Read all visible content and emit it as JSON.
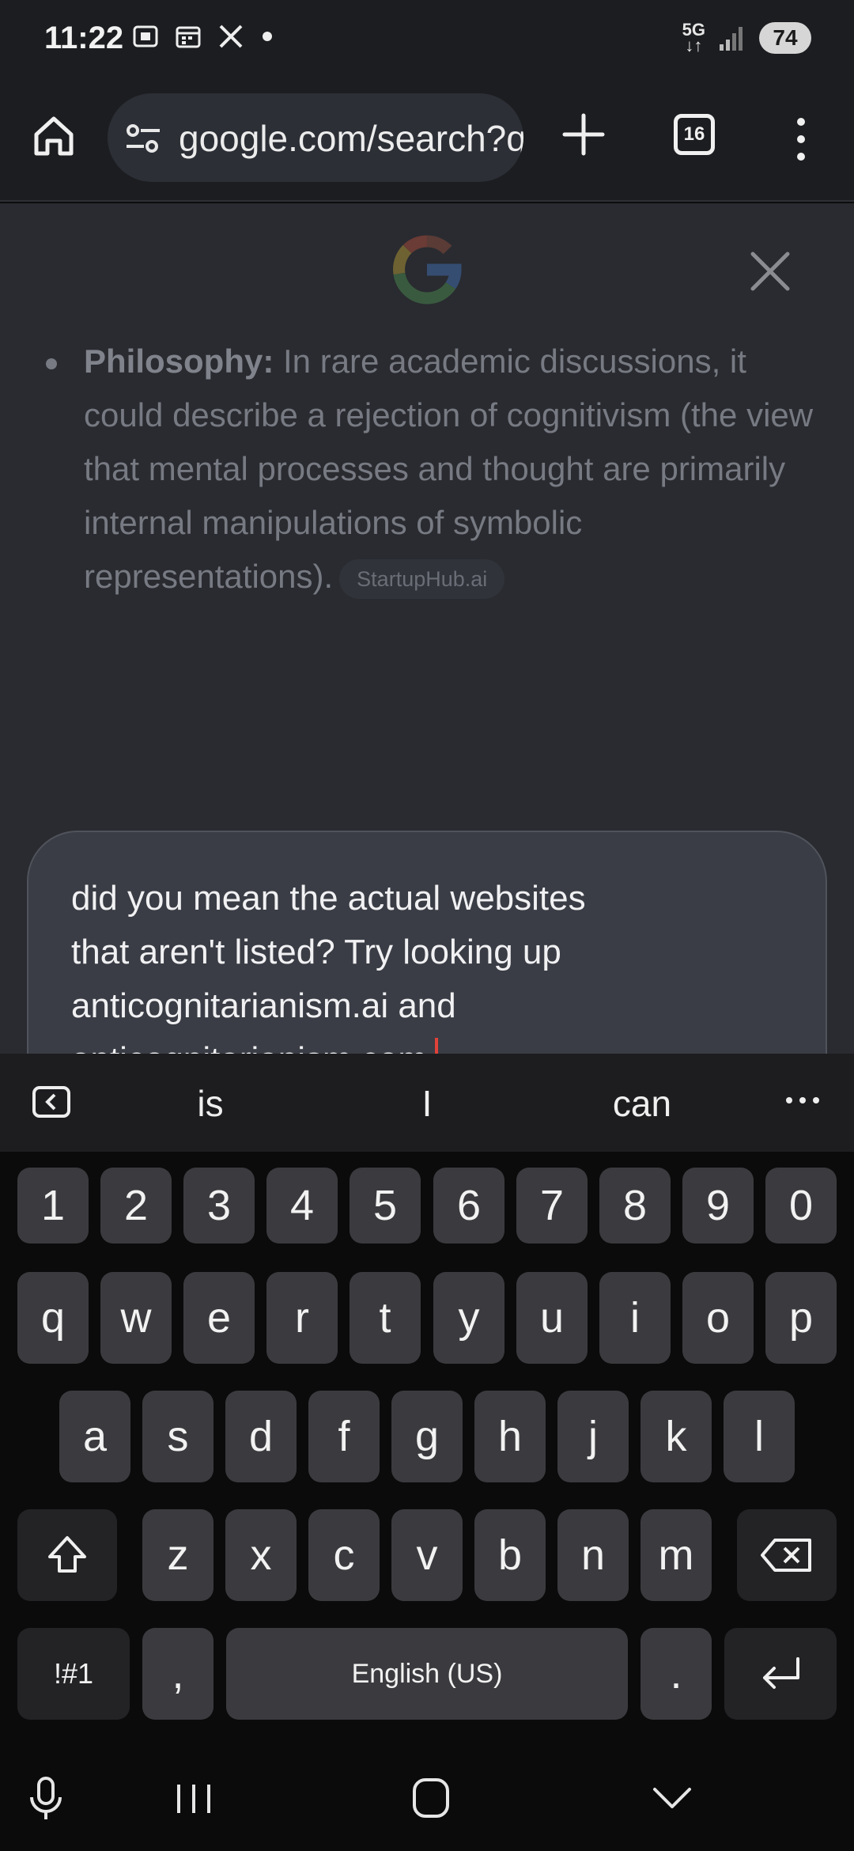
{
  "status_bar": {
    "time": "11:22",
    "network": "5G",
    "battery": "74",
    "notification_icons": [
      "screenshot-icon",
      "calendar-icon",
      "x-logo-icon",
      "dot-icon"
    ]
  },
  "browser": {
    "url": "google.com/search?q=anticognitarianism",
    "tab_count": "16"
  },
  "ai_panel": {
    "answer_label": "Philosophy:",
    "answer_text": " In rare academic discussions, it could describe a rejection of cognitivism (the view that mental processes and thought are primarily internal manipulations of symbolic representations).",
    "source_chip": "StartupHub.ai"
  },
  "composer": {
    "text": "did you mean the actual websites\nthat aren't listed? Try looking up\nanticognitarianism.ai and\nanticognitarianism.com"
  },
  "keyboard": {
    "suggestions": [
      "is",
      "I",
      "can"
    ],
    "row_numbers": [
      "1",
      "2",
      "3",
      "4",
      "5",
      "6",
      "7",
      "8",
      "9",
      "0"
    ],
    "row_1": [
      "q",
      "w",
      "e",
      "r",
      "t",
      "y",
      "u",
      "i",
      "o",
      "p"
    ],
    "row_2": [
      "a",
      "s",
      "d",
      "f",
      "g",
      "h",
      "j",
      "k",
      "l"
    ],
    "row_3": [
      "z",
      "x",
      "c",
      "v",
      "b",
      "n",
      "m"
    ],
    "symbols_key": "!#1",
    "comma_key": ",",
    "space_label": "English (US)",
    "period_key": "."
  },
  "colors": {
    "send_button": "#1f6ff0",
    "caret": "#e0423a"
  }
}
